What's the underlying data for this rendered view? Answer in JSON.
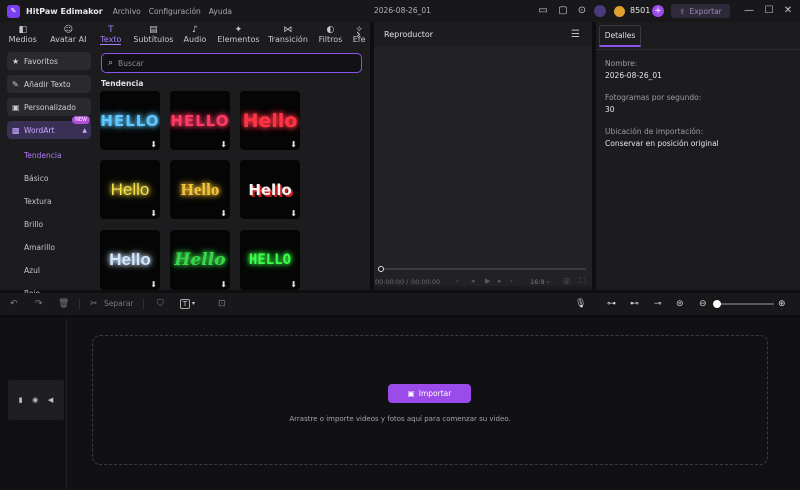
{
  "titlebar": {
    "app_name": "HitPaw Edimakor",
    "menu": [
      "Archivo",
      "Configuración",
      "Ayuda"
    ],
    "project_name": "2026-08-26_01",
    "credits": "8501",
    "export_label": "Exportar"
  },
  "tabs": [
    {
      "label": "Medios",
      "icon": "media-icon"
    },
    {
      "label": "Avatar AI",
      "icon": "avatar-icon"
    },
    {
      "label": "Texto",
      "icon": "text-icon",
      "active": true
    },
    {
      "label": "Subtítulos",
      "icon": "subtitles-icon"
    },
    {
      "label": "Audio",
      "icon": "audio-icon"
    },
    {
      "label": "Elementos",
      "icon": "elements-icon"
    },
    {
      "label": "Transición",
      "icon": "transition-icon"
    },
    {
      "label": "Filtros",
      "icon": "filters-icon"
    },
    {
      "label": "Efe",
      "icon": "effects-icon"
    }
  ],
  "sidenav": {
    "items": [
      "Favoritos",
      "Añadir Texto",
      "Personalizado",
      "WordArt"
    ],
    "new_badge": "NEW",
    "subitems": [
      "Tendencia",
      "Básico",
      "Textura",
      "Brillo",
      "Amarillo",
      "Azul",
      "Rojo"
    ]
  },
  "search": {
    "placeholder": "Buscar"
  },
  "section_title": "Tendencia",
  "wordart": [
    {
      "text": "HELLO",
      "color": "#5ec8ff"
    },
    {
      "text": "HELLO",
      "color": "#ff3a66"
    },
    {
      "text": "Hello",
      "color": "#ff3344"
    },
    {
      "text": "Hello",
      "color": "#f5e04a"
    },
    {
      "text": "Hello",
      "color": "#f2c23a"
    },
    {
      "text": "Hello",
      "color": "#e8e8e8"
    },
    {
      "text": "Hello",
      "color": "#cfe6ff"
    },
    {
      "text": "Hello",
      "color": "#38d84a"
    },
    {
      "text": "HELLO",
      "color": "#3cff4a"
    }
  ],
  "player": {
    "title": "Reproductor",
    "time_current": "00:00:00",
    "time_total": "00:00:00",
    "aspect": "16:9"
  },
  "details": {
    "tab": "Detalles",
    "name_label": "Nombre:",
    "name_value": "2026-08-26_01",
    "fps_label": "Fotogramas por segundo:",
    "fps_value": "30",
    "loc_label": "Ubicación de importación:",
    "loc_value": "Conservar en posición original"
  },
  "toolbar": {
    "split_label": "Separar"
  },
  "timeline": {
    "import_label": "Importar",
    "drop_text": "Arrastre o importe videos y fotos aquí para comenzar su video."
  },
  "colors": {
    "accent": "#9b4bea",
    "bg": "#0e0e10",
    "panel": "#1c1c1f"
  }
}
